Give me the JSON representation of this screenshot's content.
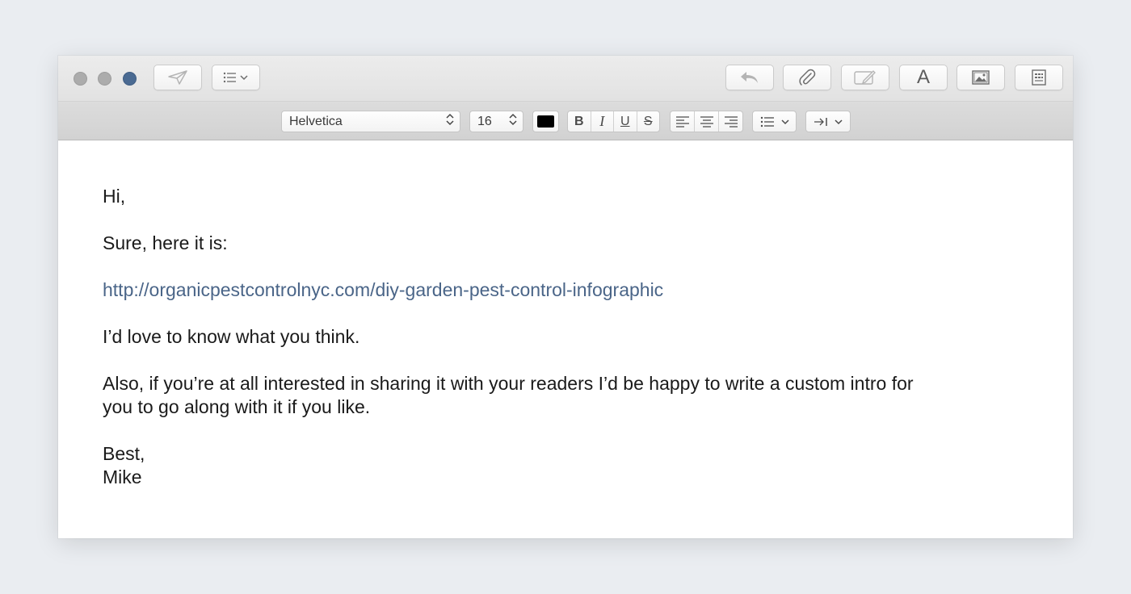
{
  "window": {
    "traffic_lights": {
      "close_color": "#acacac",
      "minimize_color": "#acacac",
      "zoom_color": "#4a6a92"
    }
  },
  "toolbar": {
    "left_icons": [
      "send-icon",
      "header-fields-icon"
    ],
    "right_icons": [
      "reply-icon",
      "attachment-icon",
      "markup-icon",
      "format-icon",
      "photo-browser-icon",
      "stationery-icon"
    ],
    "format_button_label": "A"
  },
  "format_bar": {
    "font_family": "Helvetica",
    "font_size": "16",
    "text_color": "#000000",
    "style_buttons": {
      "bold": "B",
      "italic": "I",
      "underline": "U",
      "strikethrough": "S"
    },
    "alignment_icons": [
      "align-left-icon",
      "align-center-icon",
      "align-right-icon"
    ],
    "list_icon": "list-icon",
    "indent_icon": "indent-icon"
  },
  "message": {
    "greeting": "Hi,",
    "line1": "Sure, here it is:",
    "link": "http://organicpestcontrolnyc.com/diy-garden-pest-control-infographic",
    "line2": "I’d love to know what you think.",
    "line3a": "Also, if you’re at all interested in sharing it with your readers I’d be happy to write a custom intro for",
    "line3b": "you to go along with it if you like.",
    "signoff": "Best,",
    "name": "Mike"
  }
}
